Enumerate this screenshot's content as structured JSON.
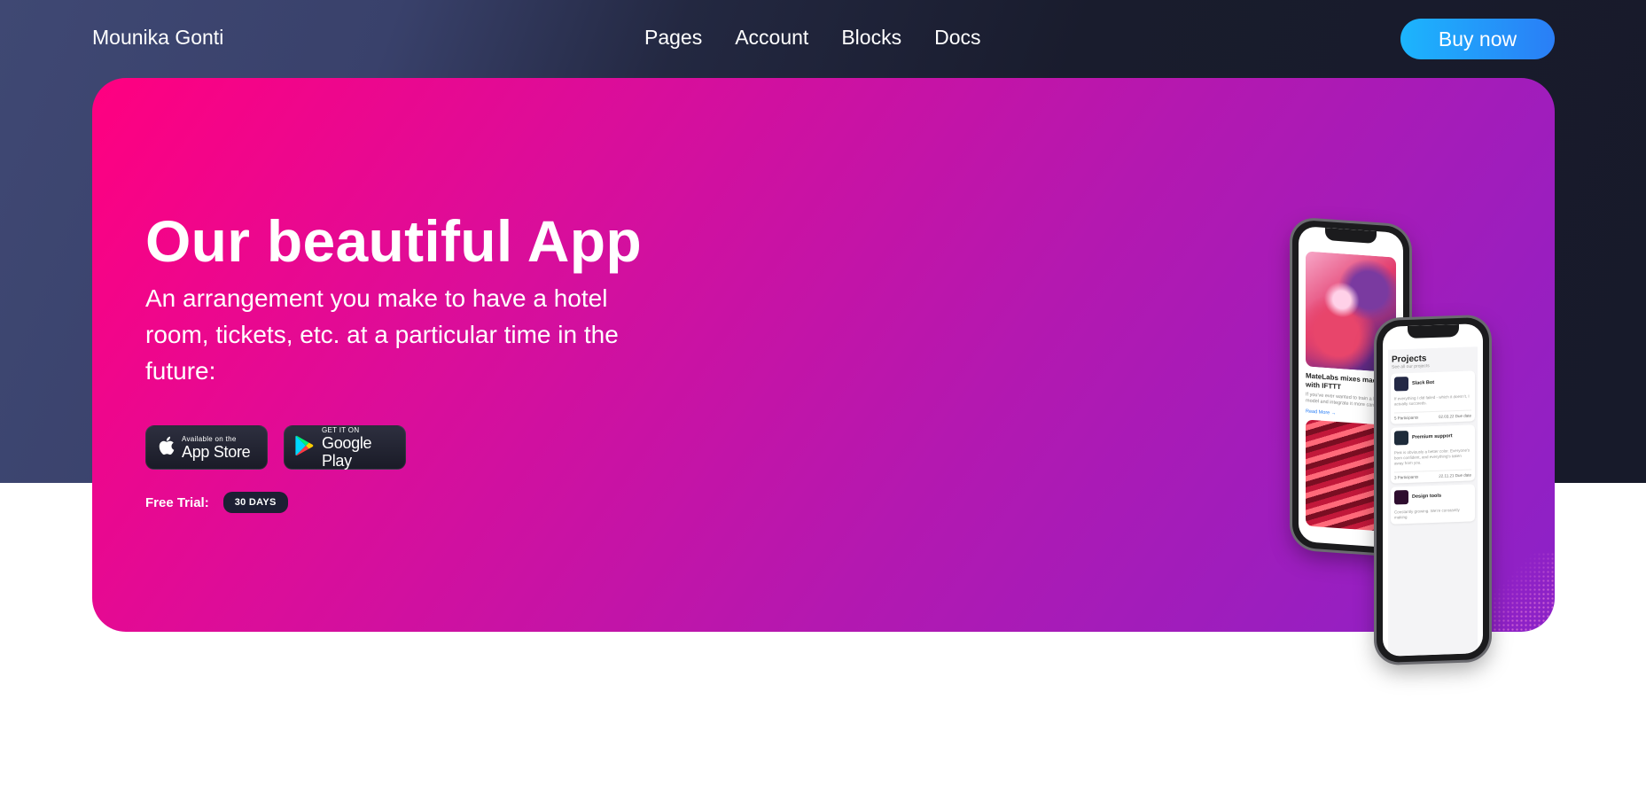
{
  "nav": {
    "brand": "Mounika Gonti",
    "links": [
      "Pages",
      "Account",
      "Blocks",
      "Docs"
    ],
    "buy_label": "Buy now"
  },
  "hero": {
    "title": "Our beautiful App",
    "subtitle": "An arrangement you make to have a hotel room, tickets, etc. at a particular time in the future:",
    "app_store": {
      "small": "Available on the",
      "big": "App Store"
    },
    "google_play": {
      "small": "GET IT ON",
      "big": "Google Play"
    },
    "trial_label": "Free Trial:",
    "trial_badge": "30 DAYS"
  },
  "phone_left": {
    "article_title": "MateLabs mixes machine with IFTTT",
    "article_text": "If you've ever wanted to train a learning model and integrate it more can with...",
    "read_more": "Read More →"
  },
  "phone_right": {
    "title": "Projects",
    "subtitle": "See all our projects",
    "projects": [
      {
        "name": "Slack Bot",
        "desc": "If everything I did failed - which it doesn't, I actually succeeds.",
        "participants": "5",
        "participants_label": "Participants",
        "date": "02.03.22",
        "date_label": "Due date"
      },
      {
        "name": "Premium support",
        "desc": "Pink is obviously a better color. Everyone's born confident, and everything's taken away from you.",
        "participants": "3",
        "participants_label": "Participants",
        "date": "22.11.21",
        "date_label": "Due date"
      },
      {
        "name": "Design tools",
        "desc": "Constantly growing. We're constantly making",
        "participants": "",
        "participants_label": "",
        "date": "",
        "date_label": ""
      }
    ]
  },
  "colors": {
    "hero_start": "#ff0080",
    "hero_end": "#8b22c8",
    "buy_button": "#2a7ef6",
    "header_bg": "#191c2d"
  },
  "icons": [
    "apple-icon",
    "google-play-icon"
  ]
}
